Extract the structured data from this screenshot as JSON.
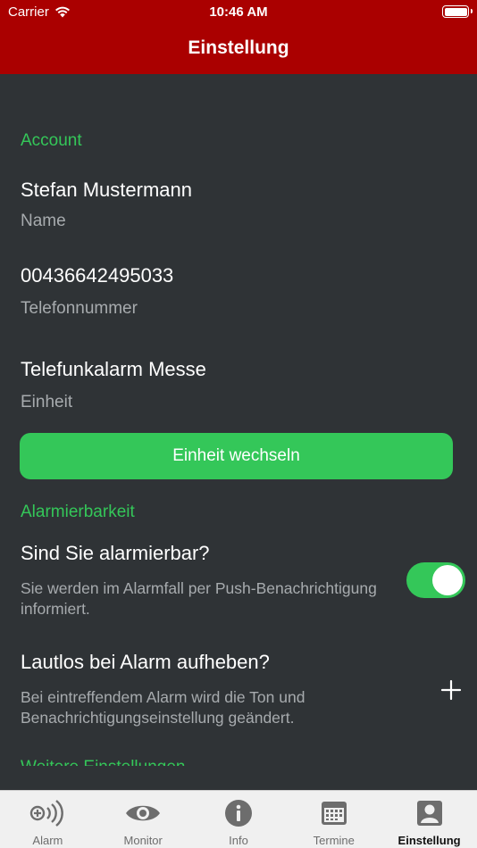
{
  "status_bar": {
    "carrier": "Carrier",
    "time": "10:46 AM"
  },
  "nav": {
    "title": "Einstellung"
  },
  "account": {
    "section_title": "Account",
    "name_value": "Stefan Mustermann",
    "name_label": "Name",
    "phone_value": "00436642495033",
    "phone_label": "Telefonnummer",
    "unit_value": "Telefunkalarm Messe",
    "unit_label": "Einheit",
    "change_unit_button": "Einheit wechseln"
  },
  "alarmability": {
    "section_title": "Alarmierbarkeit",
    "alarmable_title": "Sind Sie alarmierbar?",
    "alarmable_desc": "Sie werden im Alarmfall per Push-Benachrichtigung informiert.",
    "alarmable_on": true,
    "silent_title": "Lautlos bei Alarm aufheben?",
    "silent_desc": "Bei eintreffendem Alarm wird die Ton und Benachrichtigungseinstellung geändert.",
    "next_section_partial": "Weitere Einstellungen"
  },
  "colors": {
    "accent": "#34c759",
    "header": "#aa0000",
    "background": "#2f3336"
  },
  "tabs": [
    {
      "label": "Alarm",
      "icon": "alarm-broadcast-icon"
    },
    {
      "label": "Monitor",
      "icon": "eye-icon"
    },
    {
      "label": "Info",
      "icon": "info-icon"
    },
    {
      "label": "Termine",
      "icon": "calendar-icon"
    },
    {
      "label": "Einstellung",
      "icon": "person-icon",
      "active": true
    }
  ]
}
